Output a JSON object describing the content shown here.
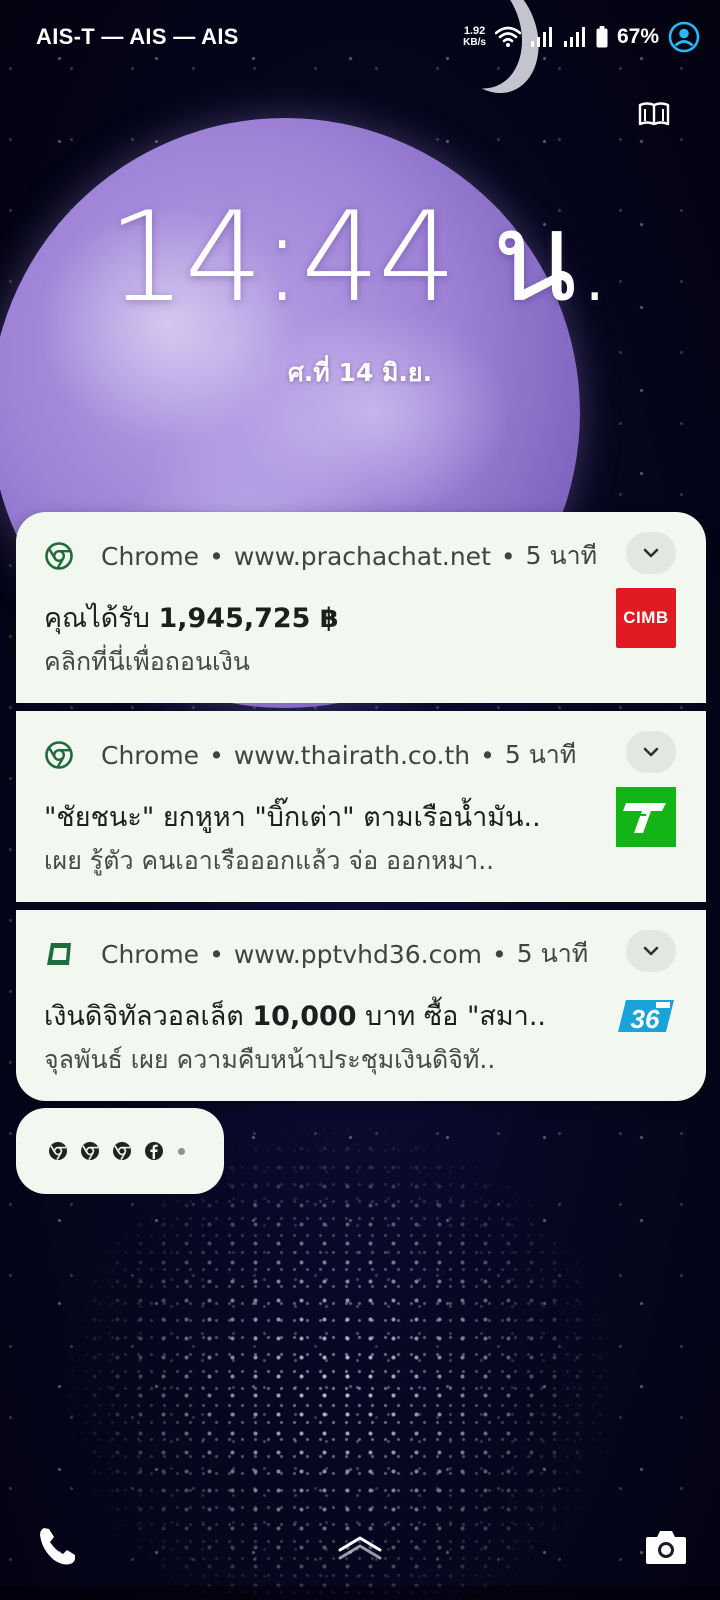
{
  "status_bar": {
    "carrier": "AIS-T — AIS — AIS",
    "net_speed_value": "1.92",
    "net_speed_unit": "KB/s",
    "battery_percent": "67%"
  },
  "lockscreen": {
    "time": "14:44 น.",
    "date": "ศ.ที่ 14 มิ.ย."
  },
  "notifications": [
    {
      "app": "Chrome",
      "source": "www.prachachat.net",
      "age": "5 นาที",
      "title_prefix": "คุณได้รับ ",
      "title_bold": "1,945,725 ฿",
      "title_suffix": "",
      "text": "คลิกที่นี่เพื่อถอนเงิน",
      "thumbnail_label": "CIMB"
    },
    {
      "app": "Chrome",
      "source": "www.thairath.co.th",
      "age": "5 นาที",
      "title_prefix": "\"ชัยชนะ\" ยกหูหา \"บิ๊กเต่า\" ตามเรือน้ำมัน..",
      "title_bold": "",
      "title_suffix": "",
      "text": "เผย รู้ตัว คนเอาเรือออกแล้ว จ่อ ออกหมา..",
      "thumbnail_label": ""
    },
    {
      "app": "Chrome",
      "source": "www.pptvhd36.com",
      "age": "5 นาที",
      "title_prefix": "เงินดิจิทัลวอลเล็ต ",
      "title_bold": "10,000",
      "title_suffix": " บาท ซื้อ \"สมา..",
      "text": "จุลพันธ์ เผย ความคืบหน้าประชุมเงินดิจิทั..",
      "thumbnail_label": ""
    }
  ],
  "separator": "•",
  "icons": {
    "status": [
      "wifi-icon",
      "signal-icon",
      "signal-icon",
      "battery-icon",
      "account-icon"
    ],
    "notification_apps": [
      "chrome-icon",
      "chrome-icon",
      "pptv-app-icon"
    ],
    "overflow": [
      "chrome-icon",
      "chrome-icon",
      "chrome-icon",
      "facebook-icon"
    ],
    "bottom": [
      "phone-icon",
      "chevron-up-icon",
      "camera-icon"
    ]
  },
  "colors": {
    "notification_bg": "#f2f7ef",
    "app_icon_green": "#1e6b3c",
    "cimb_red": "#e01b24",
    "thairath_green": "#12b418",
    "pptv_blue": "#1aa3d8",
    "account_blue": "#29b6f6"
  }
}
